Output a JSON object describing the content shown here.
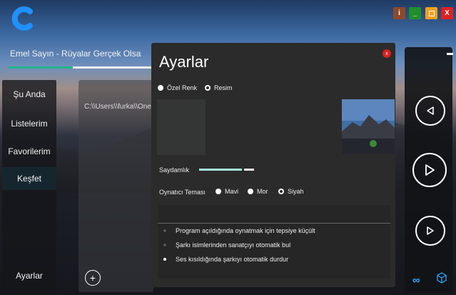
{
  "window": {
    "minimize_label": "_",
    "close_label": "X",
    "info_label": "i"
  },
  "player": {
    "now_playing": "Emel Sayın - Rüyalar Gerçek Olsa",
    "progress": 0.45
  },
  "sidebar": {
    "items": [
      {
        "label": "Şu Anda"
      },
      {
        "label": "Listelerim"
      },
      {
        "label": "Favorilerim"
      },
      {
        "label": "Keşfet"
      },
      {
        "label": "Ayarlar"
      }
    ]
  },
  "library": {
    "path": "C:\\\\Users\\\\furka\\\\OneD"
  },
  "settings": {
    "title": "Ayarlar",
    "close_label": "x",
    "background_options": [
      "Özel Renk",
      "Resim"
    ],
    "transparency_label": "Saydamlık",
    "theme_label": "Oynatıcı Teması",
    "themes": [
      "Mavi",
      "Mor",
      "Siyah"
    ],
    "options": [
      {
        "label": "Program açıldığında oynatmak için tepsiye küçült",
        "enabled": false
      },
      {
        "label": "Şarkı isimlerinden sanatçıyı otomatik bul",
        "enabled": false
      },
      {
        "label": "Ses kısıldığında şarkıyı otomatik durdur",
        "enabled": true
      }
    ]
  }
}
